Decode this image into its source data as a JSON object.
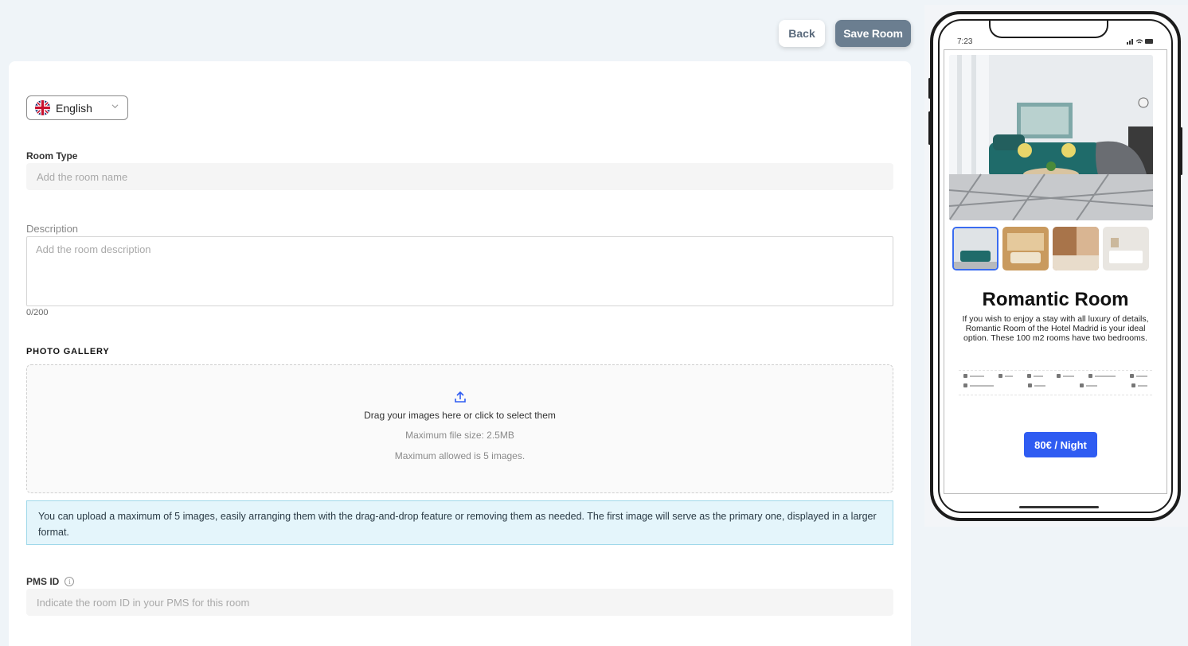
{
  "toolbar": {
    "back_label": "Back",
    "save_label": "Save Room"
  },
  "language": {
    "selected": "English"
  },
  "room_type": {
    "label": "Room Type",
    "placeholder": "Add the room name"
  },
  "description": {
    "label": "Description",
    "placeholder": "Add the room description",
    "counter": "0/200"
  },
  "gallery": {
    "title": "PHOTO GALLERY",
    "drop_text": "Drag your images here or click to select them",
    "max_size": "Maximum file size: 2.5MB",
    "max_count": "Maximum allowed is 5 images.",
    "info": "You can upload a maximum of 5 images, easily arranging them with the drag-and-drop feature or removing them as needed. The first image will serve as the primary one, displayed in a larger format."
  },
  "pms": {
    "label": "PMS ID",
    "placeholder": "Indicate the room ID in your PMS for this room"
  },
  "preview": {
    "time": "7:23",
    "title": "Romantic Room",
    "description": "If you wish to enjoy a stay with all luxury of details, Romantic Room of the Hotel Madrid is your ideal option. These 100 m2 rooms have two bedrooms.",
    "price": "80€ / Night"
  },
  "colors": {
    "accent": "#2f5cf2",
    "save_button": "#6b7e90",
    "info_bg": "#e4f5fb"
  }
}
